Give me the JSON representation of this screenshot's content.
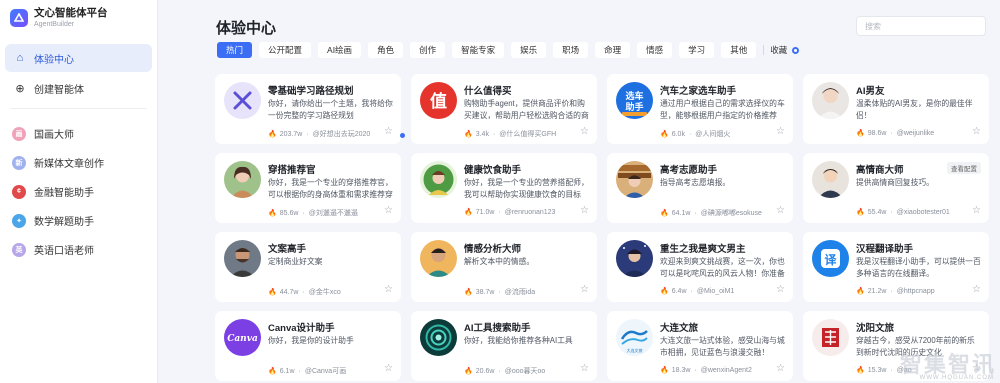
{
  "brand": {
    "title": "文心智能体平台",
    "subtitle": "AgentBuilder"
  },
  "sidebar": {
    "nav": [
      {
        "label": "体验中心",
        "icon": "home-icon",
        "active": true
      },
      {
        "label": "创建智能体",
        "icon": "plus-circle-icon",
        "active": false
      }
    ],
    "agents": [
      {
        "label": "国画大师",
        "badge": "画",
        "color": "#f0a3b8"
      },
      {
        "label": "新媒体文章创作",
        "badge": "新",
        "color": "#9fb2ee"
      },
      {
        "label": "金融智能助手",
        "badge": "¢",
        "color": "#e04a4a"
      },
      {
        "label": "数学解题助手",
        "badge": "✦",
        "color": "#4aa6e8"
      },
      {
        "label": "英语口语老师",
        "badge": "英",
        "color": "#b7a6ea"
      }
    ]
  },
  "page": {
    "title": "体验中心",
    "search_placeholder": "搜索"
  },
  "tabs": [
    "热门",
    "公开配置",
    "AI绘画",
    "角色",
    "创作",
    "智能专家",
    "娱乐",
    "职场",
    "命理",
    "情感",
    "学习",
    "其他"
  ],
  "fav_label": "收藏",
  "cards": [
    {
      "name": "零基础学习路径规划",
      "desc": "你好，请你给出一个主题，我将给你一份完整的学习路径规划",
      "heat": "203.7w",
      "author": "@好想出去玩2020",
      "avatar": "x-icon",
      "tag": ""
    },
    {
      "name": "什么值得买",
      "desc": "购物助手agent，提供商品评价和购买建议，帮助用户轻松选购合适的商品",
      "heat": "3.4k",
      "author": "@什么值得买GFH",
      "avatar": "zhi-logo",
      "tag": ""
    },
    {
      "name": "汽车之家选车助手",
      "desc": "通过用户根据自己的需求选择仪的车型，能够根据用户指定的价格推荐",
      "heat": "6.0k",
      "author": "@人间烟火",
      "avatar": "car-helper-logo",
      "tag": ""
    },
    {
      "name": "AI男友",
      "desc": "温柔体贴的AI男友，是你的最佳伴侣！",
      "heat": "98.6w",
      "author": "@weijunlike",
      "avatar": "boy-portrait",
      "tag": ""
    },
    {
      "name": "穿搭推荐官",
      "desc": "你好，我是一个专业的穿搭推荐官，可以根据你的身高体重和需求推荐穿搭",
      "heat": "85.6w",
      "author": "@刘邋遢不邋遢",
      "avatar": "girl-portrait",
      "tag": ""
    },
    {
      "name": "健康饮食助手",
      "desc": "你好，我是一个专业的营养搭配师，我可以帮助你实现健康饮食的目标",
      "heat": "71.0w",
      "author": "@renruonan123",
      "avatar": "chef-portrait",
      "tag": ""
    },
    {
      "name": "高考志愿助手",
      "desc": "指导高考志愿填报。",
      "heat": "64.1w",
      "author": "@碘源嘟嘟esokuse",
      "avatar": "library-portrait",
      "tag": ""
    },
    {
      "name": "高情商大师",
      "desc": "提供高情商回复技巧。",
      "heat": "55.4w",
      "author": "@xiaobotester01",
      "avatar": "man-portrait",
      "tag": "查看配置"
    },
    {
      "name": "文案高手",
      "desc": "定制商业好文案",
      "heat": "44.7w",
      "author": "@金牛xco",
      "avatar": "writer-portrait",
      "tag": ""
    },
    {
      "name": "情感分析大师",
      "desc": "解析文本中的情感。",
      "heat": "38.7w",
      "author": "@流雨ida",
      "avatar": "analyst-portrait",
      "tag": ""
    },
    {
      "name": "重生之我是爽文男主",
      "desc": "欢迎来到爽文挑战赛，这一次，你也可以是叱咤风云的风云人物！你准备好了吗",
      "heat": "6.4w",
      "author": "@Mio_oiM1",
      "avatar": "hero-portrait",
      "tag": ""
    },
    {
      "name": "汉程翻译助手",
      "desc": "我是汉程翻译小助手，可以提供一百多种语言的在线翻译。",
      "heat": "21.2w",
      "author": "@httpcnapp",
      "avatar": "translate-logo",
      "tag": ""
    },
    {
      "name": "Canva设计助手",
      "desc": "你好，我是你的设计助手",
      "heat": "6.1w",
      "author": "@Canva可画",
      "avatar": "canva-logo",
      "tag": ""
    },
    {
      "name": "AI工具搜索助手",
      "desc": "你好，我能给你推荐各种AI工具",
      "heat": "20.6w",
      "author": "@ooo暮天oo",
      "avatar": "spiral-logo",
      "tag": ""
    },
    {
      "name": "大连文旅",
      "desc": "大连文旅一站式体验，感受山海与城市相拥，见证蓝色与浪漫交融！",
      "heat": "18.3w",
      "author": "@wenxinAgent2",
      "avatar": "dalian-logo",
      "tag": ""
    },
    {
      "name": "沈阳文旅",
      "desc": "穿越古今，感受从7200年前的新乐到新时代沈阳的历史文化",
      "heat": "15.3w",
      "author": "@ao",
      "avatar": "shenyang-logo",
      "tag": ""
    }
  ],
  "watermark": {
    "main": "智集智讯",
    "sub": "WWW.HQGUAN.COM"
  }
}
